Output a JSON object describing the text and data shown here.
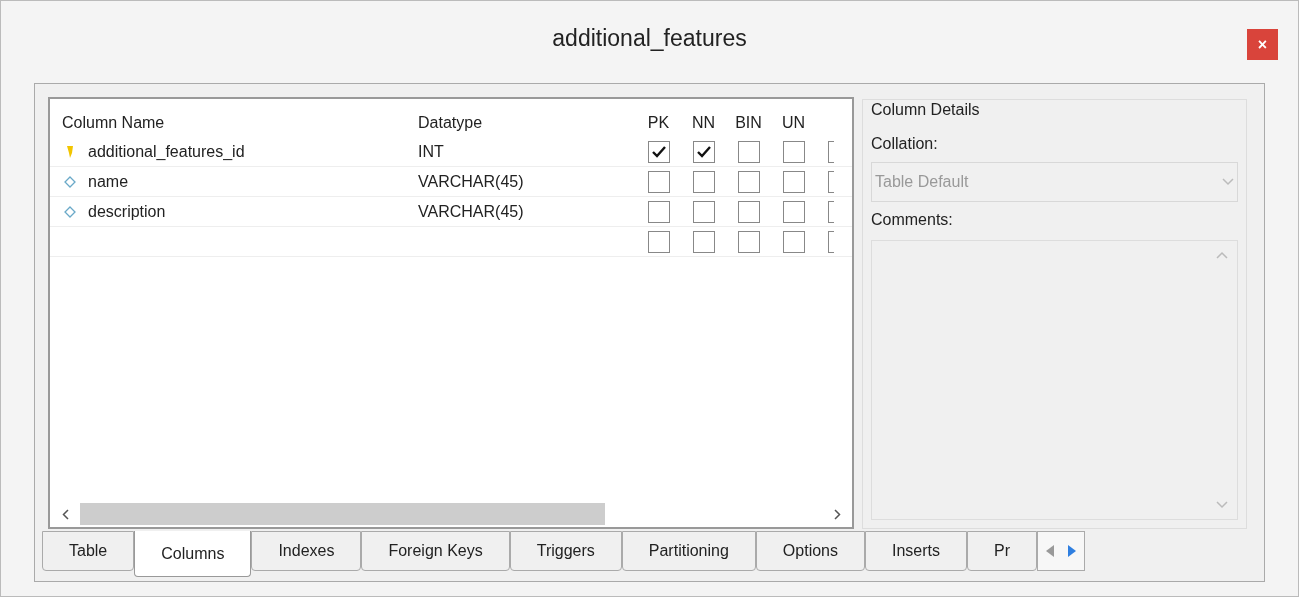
{
  "window": {
    "title": "additional_features",
    "close": "×"
  },
  "table": {
    "columns": [
      "Column Name",
      "Datatype",
      "PK",
      "NN",
      "BIN",
      "UN"
    ],
    "rows": [
      {
        "kind": "primary_key",
        "name": "additional_features_id",
        "datatype": "INT",
        "flags": [
          {
            "checked": true
          },
          {
            "checked": true
          },
          {
            "checked": false
          },
          {
            "checked": false
          },
          {
            "checked": false
          }
        ]
      },
      {
        "kind": "column",
        "name": "name",
        "datatype": "VARCHAR(45)",
        "flags": [
          {
            "checked": false
          },
          {
            "checked": false
          },
          {
            "checked": false
          },
          {
            "checked": false
          },
          {
            "checked": false
          }
        ]
      },
      {
        "kind": "column",
        "name": "description",
        "datatype": "VARCHAR(45)",
        "flags": [
          {
            "checked": false
          },
          {
            "checked": false
          },
          {
            "checked": false
          },
          {
            "checked": false
          },
          {
            "checked": false
          }
        ]
      },
      {
        "kind": "new",
        "name": "",
        "datatype": "",
        "flags": [
          {
            "checked": false
          },
          {
            "checked": false
          },
          {
            "checked": false
          },
          {
            "checked": false
          },
          {
            "checked": false
          }
        ]
      }
    ]
  },
  "column_details": {
    "title": "Column Details",
    "collation_label": "Collation:",
    "collation_value": "Table Default",
    "comments_label": "Comments:"
  },
  "tabs": [
    {
      "label": "Table",
      "selected": false
    },
    {
      "label": "Columns",
      "selected": true
    },
    {
      "label": "Indexes",
      "selected": false
    },
    {
      "label": "Foreign Keys",
      "selected": false
    },
    {
      "label": "Triggers",
      "selected": false
    },
    {
      "label": "Partitioning",
      "selected": false
    },
    {
      "label": "Options",
      "selected": false
    },
    {
      "label": "Inserts",
      "selected": false
    },
    {
      "label": "Pr",
      "selected": false
    }
  ]
}
